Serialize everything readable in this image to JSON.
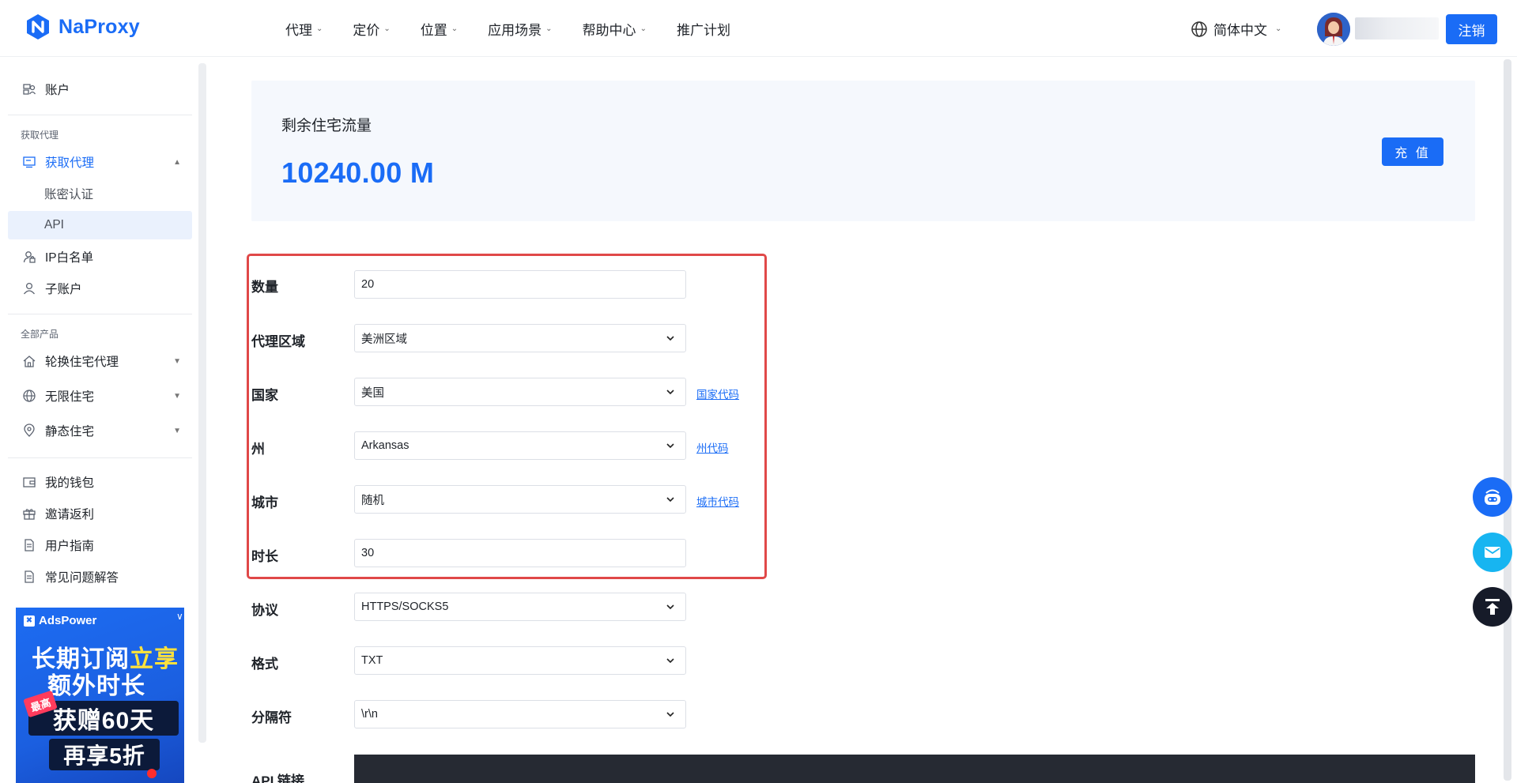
{
  "brand": {
    "name": "NaProxy",
    "color": "#1a6cf6"
  },
  "nav": [
    {
      "label": "代理",
      "has_dropdown": true
    },
    {
      "label": "定价",
      "has_dropdown": true
    },
    {
      "label": "位置",
      "has_dropdown": true
    },
    {
      "label": "应用场景",
      "has_dropdown": true
    },
    {
      "label": "帮助中心",
      "has_dropdown": true
    },
    {
      "label": "推广计划",
      "has_dropdown": false
    }
  ],
  "header": {
    "language": "简体中文",
    "logout_label": "注销"
  },
  "sidebar": {
    "account": "账户",
    "group_get_proxy": "获取代理",
    "get_proxy": "获取代理",
    "sub_auth": "账密认证",
    "sub_api": "API",
    "ip_whitelist": "IP白名单",
    "sub_account": "子账户",
    "group_all_products": "全部产品",
    "rotating_residential": "轮换住宅代理",
    "unlimited_residential": "无限住宅",
    "static_residential": "静态住宅",
    "wallet": "我的钱包",
    "invite": "邀请返利",
    "user_guide": "用户指南",
    "faq": "常见问题解答"
  },
  "promo": {
    "brand": "AdsPower",
    "line1a": "长期订阅",
    "line1b": "立享",
    "line2": "额外时长",
    "badge": "最高",
    "line3": "获赠60天",
    "line4": "再享5折"
  },
  "balance": {
    "label": "剩余住宅流量",
    "value": "10240.00 M",
    "recharge_label": "充 值"
  },
  "form": {
    "quantity": {
      "label": "数量",
      "value": "20"
    },
    "region": {
      "label": "代理区域",
      "value": "美洲区域"
    },
    "country": {
      "label": "国家",
      "value": "美国",
      "link": "国家代码"
    },
    "state": {
      "label": "州",
      "value": "Arkansas",
      "link": "州代码"
    },
    "city": {
      "label": "城市",
      "value": "随机",
      "link": "城市代码"
    },
    "duration": {
      "label": "时长",
      "value": "30"
    },
    "protocol": {
      "label": "协议",
      "value": "HTTPS/SOCKS5"
    },
    "format": {
      "label": "格式",
      "value": "TXT"
    },
    "separator": {
      "label": "分隔符",
      "value": "\\r\\n"
    },
    "api_link": {
      "label": "API 链接"
    }
  },
  "colors": {
    "accent": "#1a6cf6",
    "highlight": "#e04848",
    "card_bg": "#f5f8fd"
  }
}
